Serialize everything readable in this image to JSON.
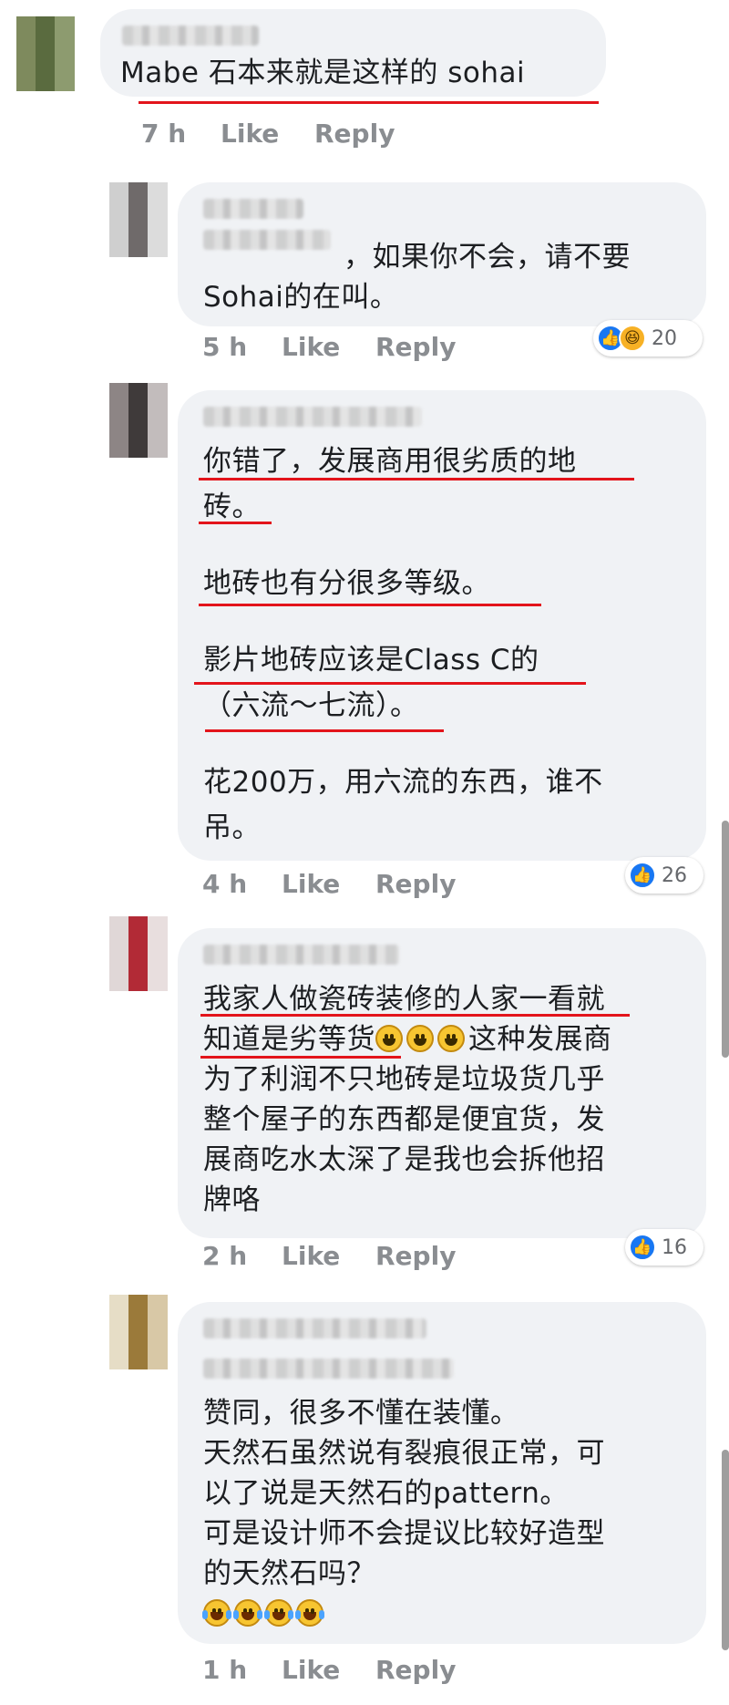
{
  "meta_labels": {
    "like": "Like",
    "reply": "Reply"
  },
  "comments": [
    {
      "name_hidden": true,
      "lines": [
        "Mabe 石本来就是这样的 sohai"
      ],
      "time": "7 h"
    },
    {
      "name_hidden": true,
      "lines": [
        "，如果你不会，请不要",
        "Sohai的在叫。"
      ],
      "time": "5 h",
      "reaction_count": "20",
      "reaction_icons": [
        "like-icon",
        "haha-icon"
      ]
    },
    {
      "name_hidden": true,
      "lines": [
        "你错了，发展商用很劣质的地",
        "砖。",
        "地砖也有分很多等级。",
        "影片地砖应该是Class C的",
        "（六流～七流）。",
        "花200万，用六流的东西，谁不",
        "吊。"
      ],
      "time": "4 h",
      "reaction_count": "26",
      "reaction_icons": [
        "like-icon"
      ]
    },
    {
      "name_hidden": true,
      "lines": [
        "我家人做瓷砖装修的人家一看就",
        "知道是劣等货",
        "这种发展商",
        "为了利润不只地砖是垃圾货几乎",
        "整个屋子的东西都是便宜货，发",
        "展商吃水太深了是我也会拆他招",
        "牌咯"
      ],
      "emoji_names": [
        "grinning-face-icon",
        "grinning-face-icon",
        "grinning-face-icon"
      ],
      "time": "2 h",
      "reaction_count": "16",
      "reaction_icons": [
        "like-icon"
      ]
    },
    {
      "name_hidden": true,
      "lines": [
        "赞同，很多不懂在装懂。",
        "天然石虽然说有裂痕很正常，可",
        "以了说是天然石的pattern。",
        "可是设计师不会提议比较好造型",
        "的天然石吗？"
      ],
      "emoji_names": [
        "tears-of-joy-icon",
        "tears-of-joy-icon",
        "tears-of-joy-icon",
        "tears-of-joy-icon"
      ],
      "time": "1 h"
    }
  ]
}
